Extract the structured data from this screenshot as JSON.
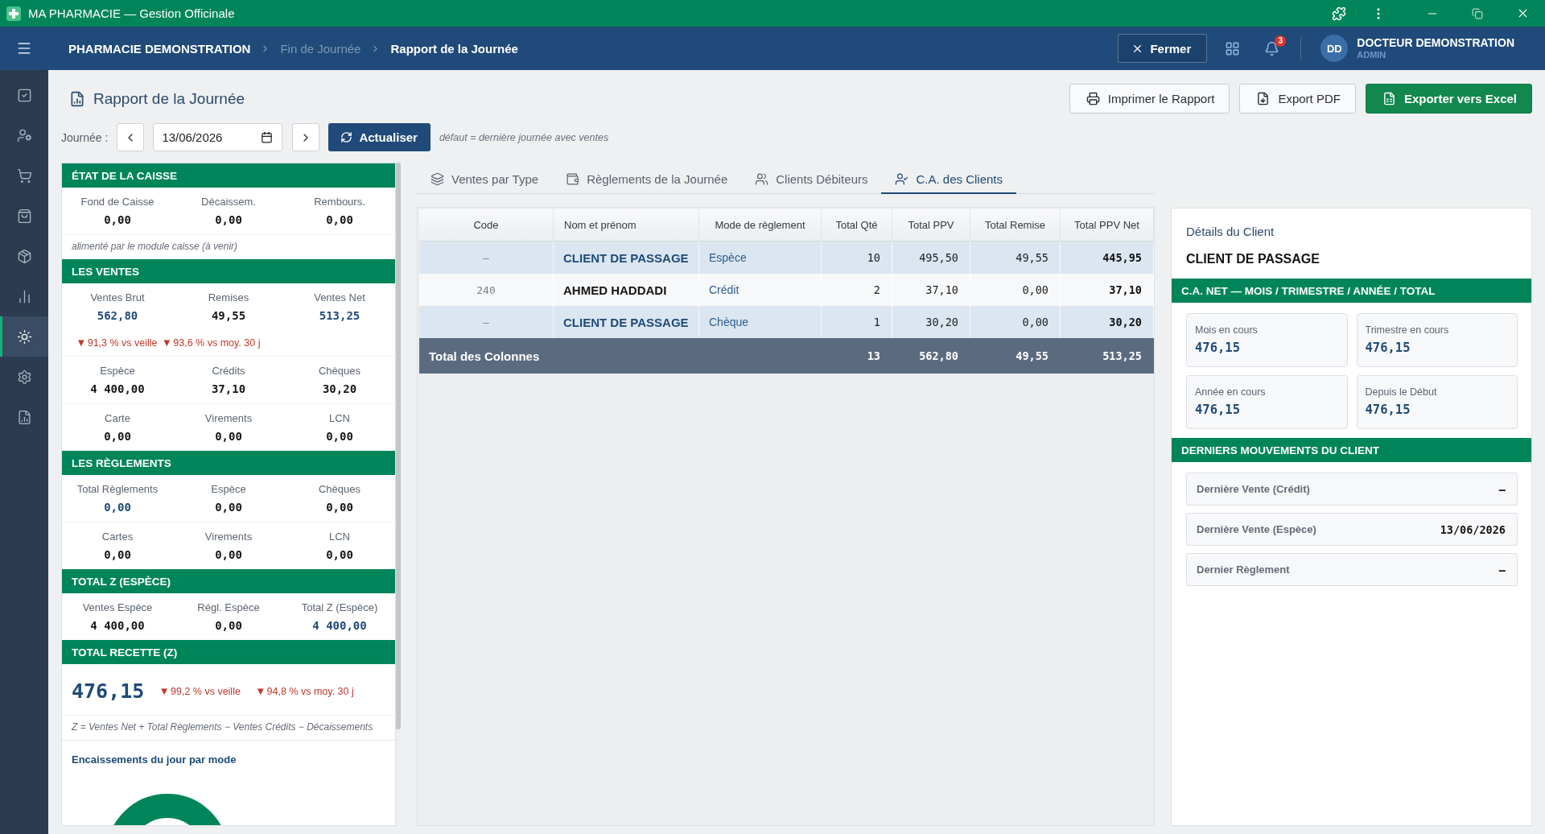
{
  "window": {
    "title": "MA PHARMACIE — Gestion Officinale"
  },
  "header": {
    "breadcrumb": [
      {
        "label": "PHARMACIE DEMONSTRATION",
        "kind": "root"
      },
      {
        "label": "Fin de Journée",
        "kind": "link"
      },
      {
        "label": "Rapport de la Journée",
        "kind": "current"
      }
    ],
    "close_button": "Fermer",
    "notification_count": "3",
    "user": {
      "initials": "DD",
      "name": "DOCTEUR DEMONSTRATION",
      "role": "ADMIN"
    }
  },
  "sidebar": {
    "items": [
      {
        "selected": false
      },
      {
        "selected": false
      },
      {
        "selected": false
      },
      {
        "selected": false
      },
      {
        "selected": false
      },
      {
        "selected": false
      },
      {
        "selected": true
      },
      {
        "selected": false
      },
      {
        "selected": false
      }
    ]
  },
  "page": {
    "title": "Rapport de la Journée",
    "actions": [
      {
        "label": "Imprimer le Rapport",
        "kind": "print"
      },
      {
        "label": "Export PDF",
        "kind": "pdf"
      },
      {
        "label": "Exporter vers Excel",
        "kind": "excel"
      }
    ]
  },
  "day_filter": {
    "label": "Journée :",
    "date": "13/06/2026",
    "refresh_button": "Actualiser",
    "hint": "défaut = dernière journée avec ventes"
  },
  "summary": {
    "sections": [
      {
        "title": "ÉTAT DE LA CAISSE",
        "blocks": [
          {
            "kind": "stats",
            "items": [
              {
                "label": "Fond de Caisse",
                "value": "0,00",
                "highlighted": false
              },
              {
                "label": "Décaissem.",
                "value": "0,00",
                "highlighted": false
              },
              {
                "label": "Rembours.",
                "value": "0,00",
                "highlighted": false
              }
            ]
          },
          {
            "kind": "note",
            "text": "alimenté par le module caisse (à venir)"
          }
        ]
      },
      {
        "title": "LES VENTES",
        "blocks": [
          {
            "kind": "stats",
            "items": [
              {
                "label": "Ventes Brut",
                "value": "562,80",
                "highlighted": true
              },
              {
                "label": "Remises",
                "value": "49,55",
                "highlighted": false
              },
              {
                "label": "Ventes Net",
                "value": "513,25",
                "highlighted": true
              }
            ]
          },
          {
            "kind": "trends",
            "items": [
              {
                "arrow": "▼",
                "text": "91,3 % vs veille"
              },
              {
                "arrow": "▼",
                "text": "93,6 % vs moy. 30 j"
              }
            ]
          },
          {
            "kind": "stats",
            "items": [
              {
                "label": "Espèce",
                "value": "4 400,00",
                "highlighted": false
              },
              {
                "label": "Crédits",
                "value": "37,10",
                "highlighted": false
              },
              {
                "label": "Chèques",
                "value": "30,20",
                "highlighted": false
              }
            ]
          },
          {
            "kind": "stats",
            "items": [
              {
                "label": "Carte",
                "value": "0,00",
                "highlighted": false
              },
              {
                "label": "Virements",
                "value": "0,00",
                "highlighted": false
              },
              {
                "label": "LCN",
                "value": "0,00",
                "highlighted": false
              }
            ]
          }
        ]
      },
      {
        "title": "LES RÈGLEMENTS",
        "blocks": [
          {
            "kind": "stats",
            "items": [
              {
                "label": "Total Règlements",
                "value": "0,00",
                "highlighted": true
              },
              {
                "label": "Espèce",
                "value": "0,00",
                "highlighted": false
              },
              {
                "label": "Chèques",
                "value": "0,00",
                "highlighted": false
              }
            ]
          },
          {
            "kind": "stats",
            "items": [
              {
                "label": "Cartes",
                "value": "0,00",
                "highlighted": false
              },
              {
                "label": "Virements",
                "value": "0,00",
                "highlighted": false
              },
              {
                "label": "LCN",
                "value": "0,00",
                "highlighted": false
              }
            ]
          }
        ]
      },
      {
        "title": "TOTAL Z (ESPÈCE)",
        "blocks": [
          {
            "kind": "stats",
            "items": [
              {
                "label": "Ventes Espèce",
                "value": "4 400,00",
                "highlighted": false
              },
              {
                "label": "Régl. Espèce",
                "value": "0,00",
                "highlighted": false
              },
              {
                "label": "Total Z (Espèce)",
                "value": "4 400,00",
                "highlighted": true
              }
            ]
          }
        ]
      },
      {
        "title": "TOTAL RECETTE (Z)",
        "blocks": [
          {
            "kind": "headline",
            "value": "476,15",
            "trends": [
              {
                "arrow": "▼",
                "text": "99,2 % vs veille"
              },
              {
                "arrow": "▼",
                "text": "94,8 % vs moy. 30 j"
              }
            ]
          },
          {
            "kind": "note",
            "text": "Z = Ventes Net + Total Règlements − Ventes Crédits − Décaissements"
          }
        ]
      }
    ],
    "chart": {
      "title": "Encaissements du jour par mode"
    }
  },
  "tabs": [
    {
      "label": "Ventes par Type",
      "selected": false
    },
    {
      "label": "Règlements de la Journée",
      "selected": false
    },
    {
      "label": "Clients Débiteurs",
      "selected": false
    },
    {
      "label": "C.A. des Clients",
      "selected": true
    }
  ],
  "table": {
    "columns": [
      "Code",
      "Nom et prénom",
      "Mode de règlement",
      "Total Qté",
      "Total PPV",
      "Total Remise",
      "Total PPV Net"
    ],
    "rows": [
      {
        "kind": "walk_in",
        "code": "—",
        "name": "CLIENT DE PASSAGE",
        "payment_mode": "Espèce",
        "qty": "10",
        "ppv": "495,50",
        "discount": "49,55",
        "net": "445,95"
      },
      {
        "kind": "account",
        "code": "240",
        "name": "AHMED HADDADI",
        "payment_mode": "Crédit",
        "qty": "2",
        "ppv": "37,10",
        "discount": "0,00",
        "net": "37,10"
      },
      {
        "kind": "walk_in",
        "code": "—",
        "name": "CLIENT DE PASSAGE",
        "payment_mode": "Chèque",
        "qty": "1",
        "ppv": "30,20",
        "discount": "0,00",
        "net": "30,20"
      }
    ],
    "totals": {
      "label": "Total des Colonnes",
      "qty": "13",
      "ppv": "562,80",
      "discount": "49,55",
      "net": "513,25"
    }
  },
  "client_details": {
    "title": "Détails du Client",
    "name": "CLIENT DE PASSAGE",
    "revenue": {
      "title": "C.A. NET — MOIS / TRIMESTRE / ANNÉE / TOTAL",
      "cards": [
        {
          "label": "Mois en cours",
          "value": "476,15"
        },
        {
          "label": "Trimestre en cours",
          "value": "476,15"
        },
        {
          "label": "Année en cours",
          "value": "476,15"
        },
        {
          "label": "Depuis le Début",
          "value": "476,15"
        }
      ]
    },
    "movements": {
      "title": "DERNIERS MOUVEMENTS DU CLIENT",
      "rows": [
        {
          "label": "Dernière Vente (Crédit)",
          "value": "—"
        },
        {
          "label": "Dernière Vente (Espèce)",
          "value": "13/06/2026"
        },
        {
          "label": "Dernier Règlement",
          "value": "—"
        }
      ]
    }
  }
}
